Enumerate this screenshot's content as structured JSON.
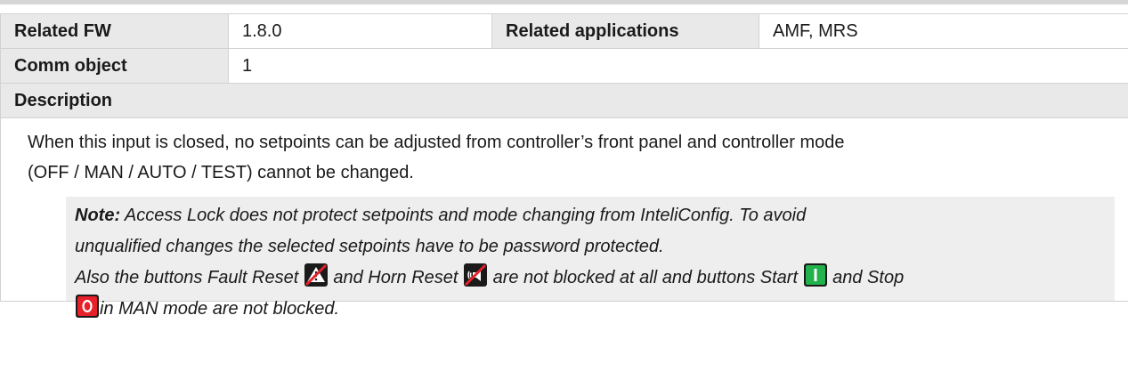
{
  "table": {
    "related_fw_label": "Related FW",
    "related_fw_value": "1.8.0",
    "related_apps_label": "Related applications",
    "related_apps_value": "AMF, MRS",
    "comm_object_label": "Comm object",
    "comm_object_value": "1",
    "description_label": "Description"
  },
  "description": {
    "line1": "When this input is closed, no setpoints can be adjusted from controller’s front panel and controller mode",
    "line2": "(OFF / MAN / AUTO / TEST) cannot be changed."
  },
  "note": {
    "prefix": "Note:",
    "text1": " Access Lock does not protect setpoints and mode changing from InteliConfig. To avoid",
    "text2": "unqualified changes the selected setpoints have to be password protected.",
    "text3a": "Also the buttons Fault Reset ",
    "text3b": " and Horn Reset ",
    "text3c": " are not blocked at all and buttons Start ",
    "text3d": " and Stop",
    "text4": "in MAN mode are not blocked.",
    "icons": [
      "fault-reset-icon",
      "horn-reset-icon",
      "start-icon",
      "stop-icon"
    ]
  },
  "colors": {
    "header_bg": "#e9e9e9",
    "note_bg": "#eeeeee",
    "start_green": "#22b14c",
    "stop_red": "#e8202a"
  }
}
